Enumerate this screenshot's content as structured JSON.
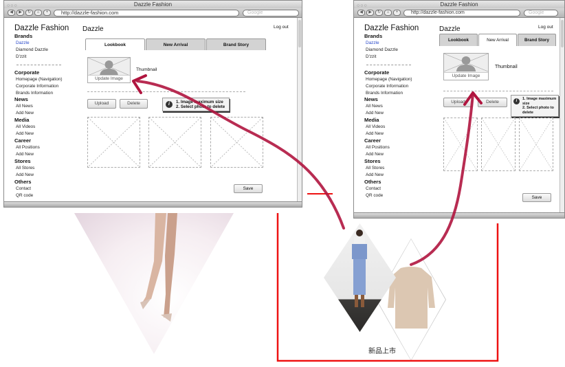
{
  "browser": {
    "title": "Dazzle Fashion",
    "url": "http://dazzle-fashion.com",
    "search_placeholder": "Google"
  },
  "wireframe": {
    "brand": "Dazzle Fashion",
    "page_title": "Dazzle",
    "logout": "Log out",
    "sidebar": {
      "brands": {
        "heading": "Brands",
        "items": [
          "Dazzle",
          "Diamond Dazzle",
          "D'zzit"
        ]
      },
      "corporate": {
        "heading": "Corporate",
        "items": [
          "Homepage (Navigation)",
          "Corporate Information",
          "Brands Information"
        ]
      },
      "news": {
        "heading": "News",
        "items": [
          "All News",
          "Add New"
        ]
      },
      "media": {
        "heading": "Media",
        "items": [
          "All Videos",
          "Add New"
        ]
      },
      "career": {
        "heading": "Career",
        "items": [
          "All Positions",
          "Add New"
        ]
      },
      "stores": {
        "heading": "Stores",
        "items": [
          "All Stores",
          "Add New"
        ]
      },
      "others": {
        "heading": "Others",
        "items": [
          "Contact",
          "QR code"
        ]
      }
    },
    "tabs": [
      "Lookbook",
      "New Arrival",
      "Brand Story"
    ],
    "update_image": "Update Image",
    "thumbnail_label": "Thumbnail",
    "upload": "Upload",
    "delete": "Delete",
    "tooltip": [
      "1. Image maximum size",
      "2. Select photo to delete"
    ],
    "save": "Save"
  },
  "windows": {
    "left": {
      "active_tab": "Lookbook"
    },
    "right": {
      "active_tab": "New Arrival"
    }
  },
  "new_arrival_caption": "新品上市",
  "annotation_color": "#b0153f",
  "frame_color": "#ee1111"
}
